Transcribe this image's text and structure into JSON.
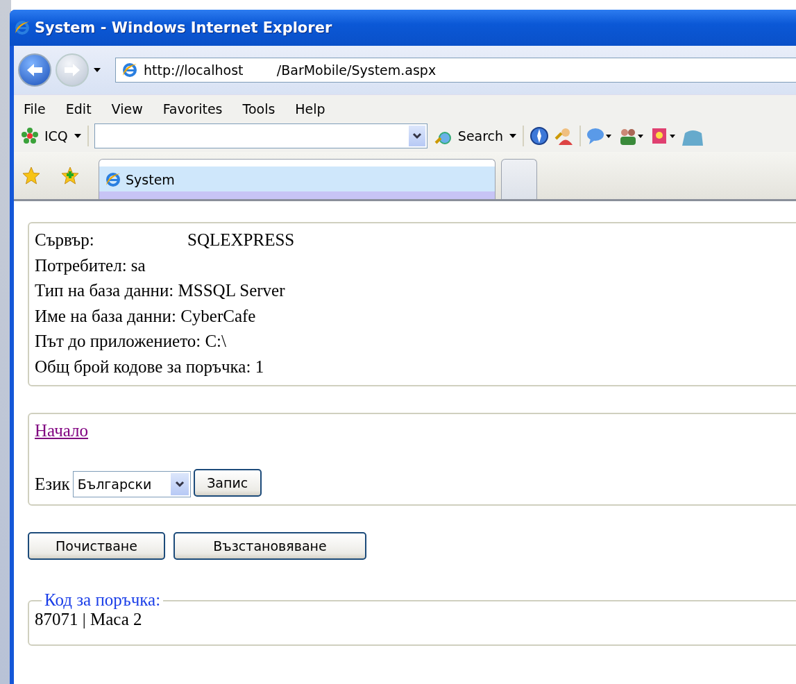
{
  "window": {
    "title": "System - Windows Internet Explorer"
  },
  "address_bar": {
    "url": "http://localhost        /BarMobile/System.aspx"
  },
  "menu": [
    "File",
    "Edit",
    "View",
    "Favorites",
    "Tools",
    "Help"
  ],
  "toolbar": {
    "icq_label": "ICQ",
    "search_label": "Search"
  },
  "tabs": [
    {
      "label": "System",
      "selected": true
    },
    {
      "selected": false
    }
  ],
  "server_info": {
    "server_label": "Сървър:",
    "server_value": "SQLEXPRESS",
    "lines": [
      "Потребител: sa",
      "Тип на база данни: MSSQL Server",
      "Име на база данни: CyberCafe",
      "Път до приложението: C:\\",
      "Общ брой кодове за поръчка: 1"
    ]
  },
  "navigation": {
    "home_link": "Начало",
    "language_label": "Език",
    "language_select": "Български",
    "save_button": "Запис"
  },
  "actions": [
    "Почистване",
    "Възстановяване"
  ],
  "order_code": {
    "legend": "Код за поръчка:",
    "value": "87071 | Маса 2"
  }
}
